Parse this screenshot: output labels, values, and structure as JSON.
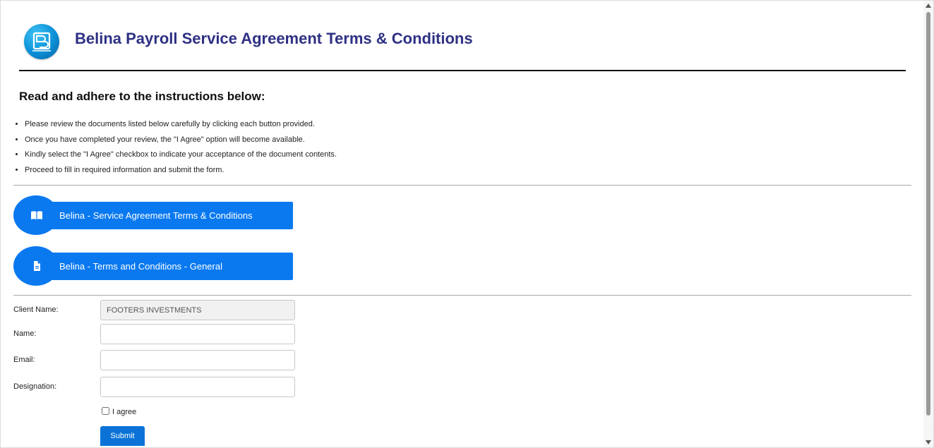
{
  "header": {
    "logo_icon": "belina-logo-icon",
    "title": "Belina Payroll Service Agreement Terms & Conditions"
  },
  "instructions": {
    "heading": "Read and adhere to the instructions below:",
    "items": [
      "Please review the documents listed below carefully by clicking each button provided.",
      "Once you have completed your review, the \"I Agree\" option will become available.",
      "Kindly select the \"I Agree\" checkbox to indicate your acceptance of the document contents.",
      "Proceed to fill in required information and submit the form."
    ]
  },
  "documents": [
    {
      "label": "Belina - Service Agreement Terms & Conditions",
      "icon": "book-open-icon"
    },
    {
      "label": "Belina - Terms and Conditions - General",
      "icon": "file-document-icon"
    }
  ],
  "form": {
    "client_name_label": "Client Name:",
    "client_name_value": "FOOTERS INVESTMENTS",
    "name_label": "Name:",
    "name_value": "",
    "email_label": "Email:",
    "email_value": "",
    "designation_label": "Designation:",
    "designation_value": "",
    "agree_label": "I agree",
    "submit_label": "Submit"
  },
  "colors": {
    "title": "#2e3184",
    "button": "#0a79f0",
    "submit": "#0b73d8"
  }
}
